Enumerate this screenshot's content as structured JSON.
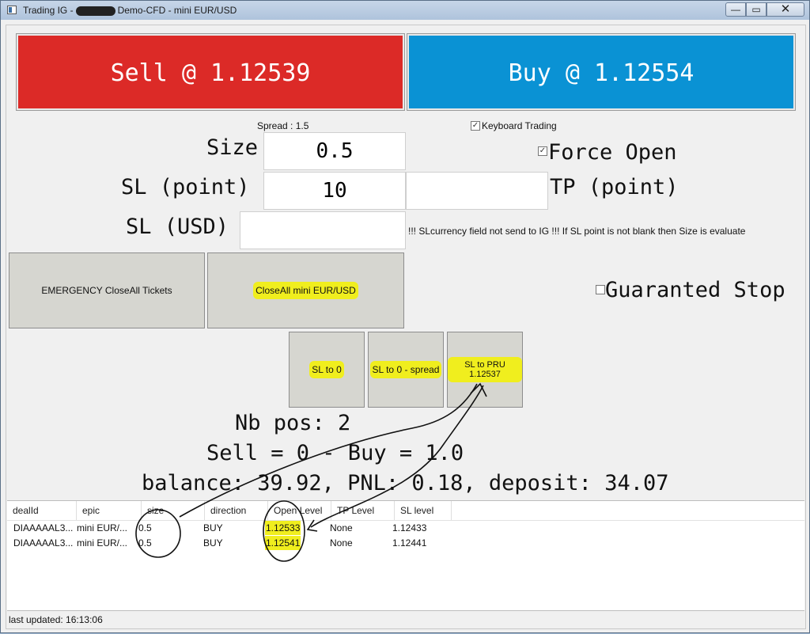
{
  "window": {
    "title_prefix": "Trading IG -",
    "title_suffix": "Demo-CFD - mini EUR/USD",
    "min_label": "—",
    "max_label": "▭",
    "close_label": "✕"
  },
  "trade": {
    "sell_label": "Sell @ 1.12539",
    "buy_label": "Buy @ 1.12554",
    "spread_label": "Spread : 1.5",
    "keyboard_trading_label": "Keyboard Trading",
    "keyboard_trading_checked": true,
    "size_label": "Size",
    "size_value": "0.5",
    "sl_point_label": "SL (point)",
    "sl_point_value": "10",
    "tp_point_value": "",
    "tp_point_label": "TP (point)",
    "force_open_label": "Force Open",
    "force_open_checked": true,
    "sl_usd_label": "SL (USD)",
    "sl_usd_value": "",
    "sl_usd_note": "!!! SLcurrency field not send to IG !!! If SL point is not blank then Size is evaluate",
    "guaranteed_stop_label": "Guaranted Stop",
    "guaranteed_stop_checked": false
  },
  "actions": {
    "emergency_close_label": "EMERGENCY CloseAll Tickets",
    "close_all_label": "CloseAll mini EUR/USD",
    "sl_to_zero_label": "SL to 0",
    "sl_to_zero_spread_label": "SL to 0 - spread",
    "sl_to_pru_label": "SL to PRU 1.12537"
  },
  "summary": {
    "nb_pos": "Nb pos: 2",
    "sell_buy": "Sell = 0 - Buy = 1.0",
    "balance": "balance: 39.92, PNL: 0.18, deposit: 34.07"
  },
  "positions": {
    "columns": [
      "dealId",
      "epic",
      "size",
      "direction",
      "Open Level",
      "TP Level",
      "SL level"
    ],
    "rows": [
      [
        "DIAAAAAL3...",
        "mini EUR/...",
        "0.5",
        "BUY",
        "1.12533",
        "None",
        "1.12433"
      ],
      [
        "DIAAAAAL3...",
        "mini EUR/...",
        "0.5",
        "BUY",
        "1.12541",
        "None",
        "1.12441"
      ]
    ]
  },
  "status": {
    "last_updated": "last updated: 16:13:06"
  },
  "colors": {
    "sell": "#dc2a27",
    "buy": "#0a92d4",
    "highlight": "#f0ee1e"
  }
}
